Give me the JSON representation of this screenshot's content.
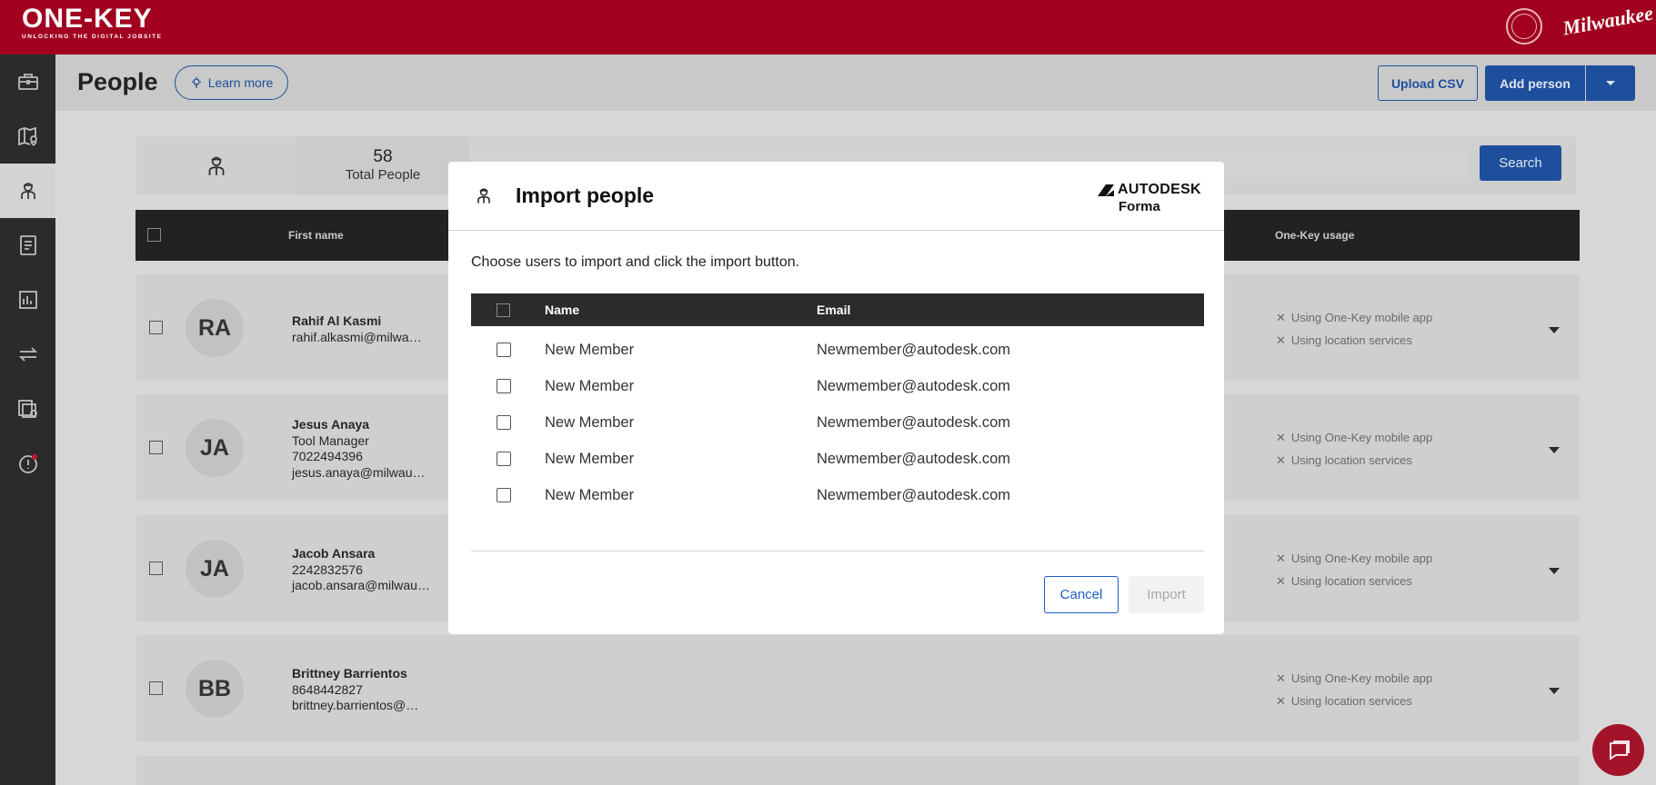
{
  "app": {
    "logo_text": "ONE-KEY",
    "logo_tagline": "UNLOCKING THE DIGITAL JOBSITE",
    "brand": "Milwaukee"
  },
  "sidebar": {
    "items": [
      {
        "icon": "toolbox-icon"
      },
      {
        "icon": "map-pin-icon"
      },
      {
        "icon": "people-icon",
        "active": true
      },
      {
        "icon": "report-icon"
      },
      {
        "icon": "analytics-icon"
      },
      {
        "icon": "transfer-icon"
      },
      {
        "icon": "user-devices-icon"
      },
      {
        "icon": "alert-icon"
      }
    ]
  },
  "header": {
    "title": "People",
    "learn_more": "Learn more",
    "upload_csv": "Upload CSV",
    "add_person": "Add person"
  },
  "stats": {
    "total_count": "58",
    "total_label": "Total People",
    "search_button": "Search"
  },
  "table": {
    "col_first_name": "First name",
    "col_usage": "One-Key usage",
    "usage_mobile": "Using One-Key mobile app",
    "usage_location": "Using location services",
    "people": [
      {
        "initials": "RA",
        "name": "Rahif Al Kasmi",
        "lines": [
          "rahif.alkasmi@milwa…"
        ]
      },
      {
        "initials": "JA",
        "name": "Jesus Anaya",
        "lines": [
          "Tool Manager",
          "7022494396",
          "jesus.anaya@milwau…"
        ]
      },
      {
        "initials": "JA",
        "name": "Jacob Ansara",
        "lines": [
          "2242832576",
          "jacob.ansara@milwau…"
        ]
      },
      {
        "initials": "BB",
        "name": "Brittney Barrientos",
        "lines": [
          "8648442827",
          "brittney.barrientos@…"
        ]
      }
    ]
  },
  "modal": {
    "title": "Import people",
    "partner_brand": "AUTODESK",
    "partner_product": "Forma",
    "instruction": "Choose users to import and click the import button.",
    "col_name": "Name",
    "col_email": "Email",
    "rows": [
      {
        "name": "New Member",
        "email": "Newmember@autodesk.com"
      },
      {
        "name": "New Member",
        "email": "Newmember@autodesk.com"
      },
      {
        "name": "New Member",
        "email": "Newmember@autodesk.com"
      },
      {
        "name": "New Member",
        "email": "Newmember@autodesk.com"
      },
      {
        "name": "New Member",
        "email": "Newmember@autodesk.com"
      }
    ],
    "cancel": "Cancel",
    "import": "Import"
  },
  "colors": {
    "brand_red": "#a1001e",
    "primary_blue": "#1e4f9c",
    "cancel_blue": "#1e5bc6"
  }
}
